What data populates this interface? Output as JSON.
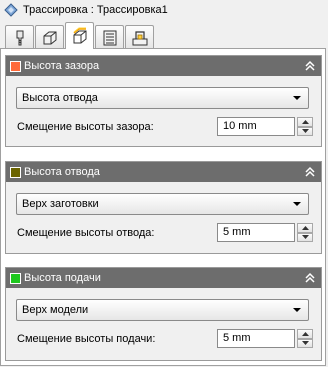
{
  "window": {
    "title": "Трассировка : Трассировка1"
  },
  "tabs": [
    {
      "icon": "tool-icon"
    },
    {
      "icon": "stock-box-icon"
    },
    {
      "icon": "heights-icon",
      "active": true
    },
    {
      "icon": "passes-icon"
    },
    {
      "icon": "linking-icon"
    }
  ],
  "groups": [
    {
      "title": "Высота зазора",
      "swatch": "#ff6a3a",
      "dropdown_value": "Высота отвода",
      "offset_label": "Смещение высоты зазора:",
      "offset_value": "10 mm"
    },
    {
      "title": "Высота отвода",
      "swatch": "#6b6400",
      "dropdown_value": "Верх заготовки",
      "offset_label": "Смещение высоты отвода:",
      "offset_value": "5 mm"
    },
    {
      "title": "Высота подачи",
      "swatch": "#1ec81e",
      "dropdown_value": "Верх модели",
      "offset_label": "Смещение высоты подачи:",
      "offset_value": "5 mm"
    }
  ]
}
